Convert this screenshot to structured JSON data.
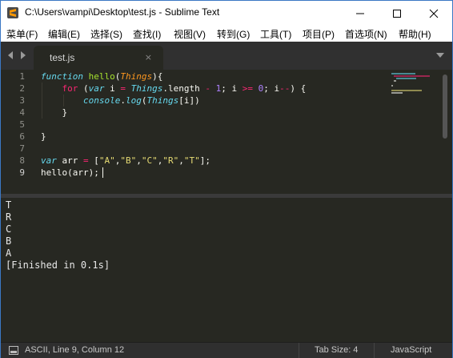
{
  "window": {
    "title": "C:\\Users\\vampi\\Desktop\\test.js - Sublime Text"
  },
  "menu": [
    {
      "label": "菜单(F)"
    },
    {
      "label": "编辑(E)"
    },
    {
      "label": "选择(S)"
    },
    {
      "label": "查找(I)"
    },
    {
      "label": "视图(V)"
    },
    {
      "label": "转到(G)"
    },
    {
      "label": "工具(T)"
    },
    {
      "label": "项目(P)"
    },
    {
      "label": "首选项(N)"
    },
    {
      "label": "帮助(H)"
    }
  ],
  "tabs": [
    {
      "label": "test.js",
      "close": "×"
    }
  ],
  "editor": {
    "line_numbers": [
      "1",
      "2",
      "3",
      "4",
      "5",
      "6",
      "7",
      "8",
      "9"
    ],
    "active_line": "9",
    "code": {
      "l1": {
        "kw": "function",
        "sp1": " ",
        "name": "hello",
        "open": "(",
        "param": "Things",
        "close": "){"
      },
      "l2": {
        "indent": "    ",
        "kw_for": "for",
        "sp": " (",
        "kw_var": "var",
        "rest1": " i ",
        "eq": "=",
        "sp2": " ",
        "cls": "Things",
        "rest2": ".length ",
        "minus": "-",
        "sp3": " ",
        "one": "1",
        "semi1": "; i ",
        "ge": ">=",
        "sp4": " ",
        "zero": "0",
        "semi2": "; i",
        "dec": "--",
        "end": ") {"
      },
      "l3": {
        "indent": "        ",
        "console": "console",
        "dot": ".",
        "log": "log",
        "paren": "(",
        "cls": "Things",
        "rest": "[i])"
      },
      "l4": {
        "text": "    }"
      },
      "l6": {
        "text": "}"
      },
      "l8": {
        "kw": "var",
        "rest1": " arr ",
        "eq": "=",
        "open": " [",
        "s1": "\"A\"",
        "c1": ",",
        "s2": "\"B\"",
        "c2": ",",
        "s3": "\"C\"",
        "c3": ",",
        "s4": "\"R\"",
        "c4": ",",
        "s5": "\"T\"",
        "end": "];"
      },
      "l9": {
        "text": "hello(arr);"
      }
    }
  },
  "output": {
    "lines": [
      "T",
      "R",
      "C",
      "B",
      "A",
      "[Finished in 0.1s]"
    ]
  },
  "status": {
    "position": "ASCII, Line 9, Column 12",
    "tab_size": "Tab Size: 4",
    "syntax": "JavaScript"
  },
  "colors": {
    "editor_bg": "#272822",
    "keyword": "#66d9ef",
    "control": "#f92672",
    "function": "#a6e22e",
    "parameter": "#fd971f",
    "number": "#ae81ff",
    "string": "#e6db74"
  },
  "icons": {
    "app": "sublime-text-icon",
    "minimize": "minimize-icon",
    "maximize": "maximize-icon",
    "close": "close-icon",
    "nav_left": "chevron-left-icon",
    "nav_right": "chevron-right-icon",
    "tab_menu": "chevron-down-icon",
    "status_panel": "panel-toggle-icon"
  }
}
